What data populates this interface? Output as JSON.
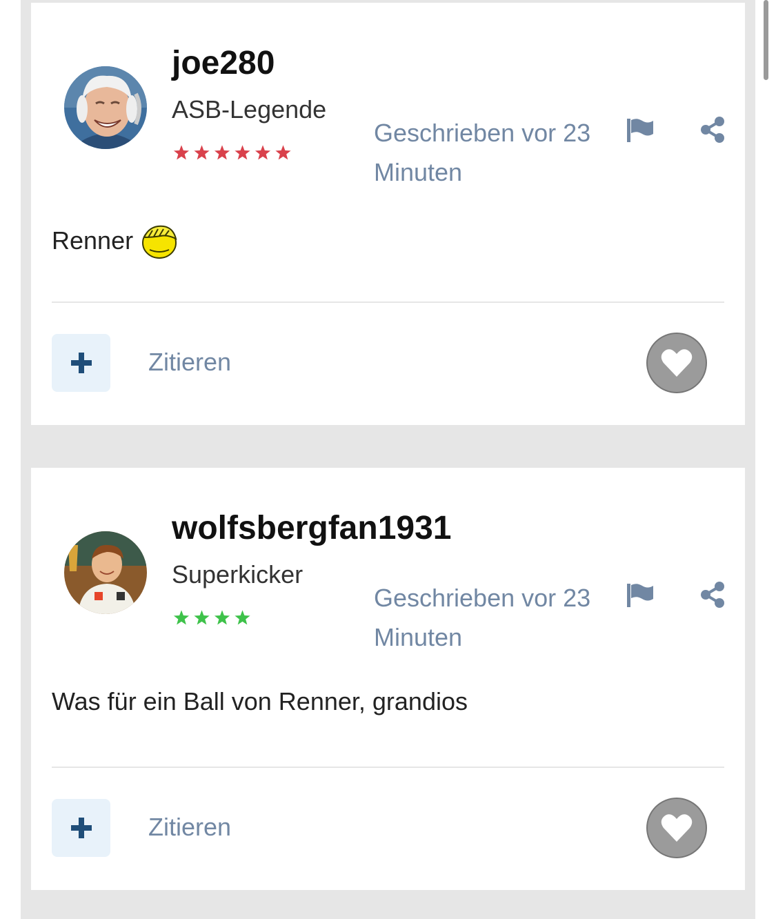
{
  "posts": [
    {
      "username": "joe280",
      "rank": "ASB-Legende",
      "star_count": 6,
      "star_color": "#d9414b",
      "timestamp": "Geschrieben vor 23 Minuten",
      "content": "Renner",
      "has_emoji": true,
      "quote_label": "Zitieren"
    },
    {
      "username": "wolfsbergfan1931",
      "rank": "Superkicker",
      "star_count": 4,
      "star_color": "#3ec24a",
      "timestamp": "Geschrieben vor 23 Minuten",
      "content": "Was für ein Ball von Renner, grandios",
      "has_emoji": false,
      "quote_label": "Zitieren"
    }
  ],
  "colors": {
    "accent": "#7187a3",
    "feed_background": "#e6e6e6",
    "add_button_bg": "#e8f2fa",
    "add_button_icon": "#1f4e79",
    "like_button": "#9b9b9b"
  },
  "icons": [
    "flag-icon",
    "share-icon",
    "plus-icon",
    "heart-icon",
    "facepalm-emoji"
  ]
}
